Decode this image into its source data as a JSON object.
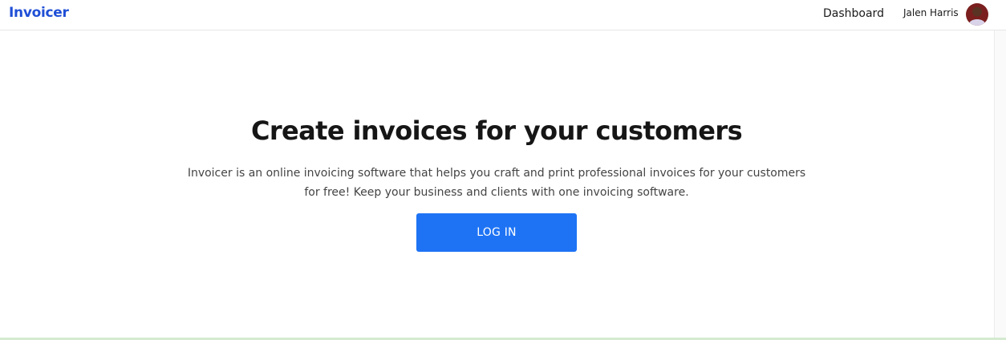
{
  "navbar": {
    "brand": "Invoicer",
    "dashboard_link": "Dashboard",
    "user_name": "Jalen Harris",
    "avatar_icon": "user-avatar"
  },
  "hero": {
    "title": "Create invoices for your customers",
    "description": "Invoicer is an online invoicing software that helps you craft and print professional invoices for your customers for free! Keep your business and clients with one invoicing software.",
    "login_button": "LOG IN"
  },
  "colors": {
    "brand": "#1f4fd6",
    "button": "#1e73f4",
    "text": "#161616"
  }
}
